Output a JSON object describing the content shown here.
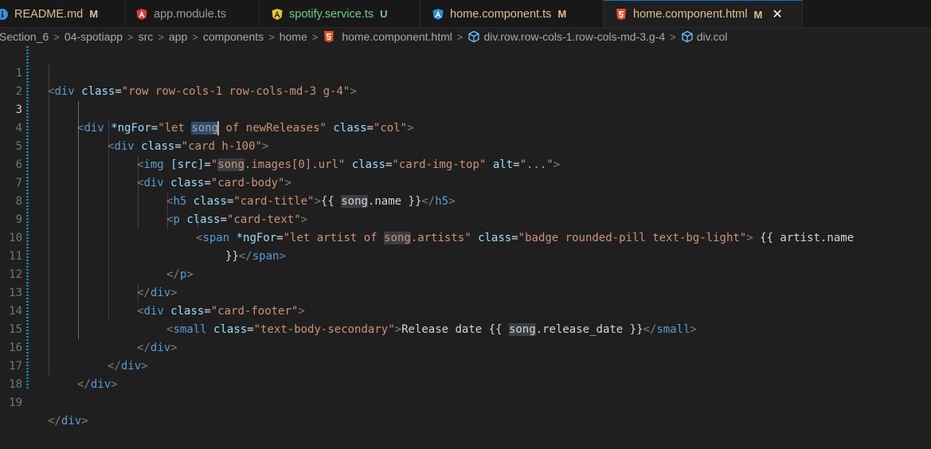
{
  "tabs": [
    {
      "label": "README.md",
      "status": "M",
      "icon": "info-icon",
      "active": false
    },
    {
      "label": "app.module.ts",
      "status": "",
      "icon": "angular-icon",
      "active": false
    },
    {
      "label": "spotify.service.ts",
      "status": "U",
      "icon": "angular-service-icon",
      "active": false
    },
    {
      "label": "home.component.ts",
      "status": "M",
      "icon": "angular-component-icon",
      "active": false
    },
    {
      "label": "home.component.html",
      "status": "M",
      "icon": "html5-icon",
      "active": true
    }
  ],
  "breadcrumb": [
    "Section_6",
    "04-spotiapp",
    "src",
    "app",
    "components",
    "home",
    "home.component.html",
    "div.row.row-cols-1.row-cols-md-3.g-4",
    "div.col"
  ],
  "line_numbers": [
    "1",
    "2",
    "3",
    "4",
    "5",
    "6",
    "7",
    "8",
    "9",
    "10",
    "11",
    "12",
    "13",
    "14",
    "15",
    "16",
    "17",
    "18",
    "19"
  ],
  "current_line": "3",
  "code": {
    "l1": {
      "o": "<",
      "tag": "div",
      "sp": " ",
      "a1": "class",
      "eq": "=",
      "v1": "\"row row-cols-1 row-cols-md-3 g-4\"",
      "c": ">"
    },
    "l3": {
      "o": "<",
      "tag": "div",
      "a1": "*ngFor",
      "eq": "=",
      "v1a": "\"let ",
      "sel": "song",
      "v1b": " of newReleases\"",
      "a2": "class",
      "v2": "\"col\"",
      "c": ">"
    },
    "l4": {
      "o": "<",
      "tag": "div",
      "a1": "class",
      "eq": "=",
      "v1": "\"card h-100\"",
      "c": ">"
    },
    "l5": {
      "o": "<",
      "tag": "img",
      "a1": "[src]",
      "eq": "=",
      "v1a": "\"",
      "hl": "song",
      "v1b": ".images[0].url\"",
      "a2": "class",
      "v2": "\"card-img-top\"",
      "a3": "alt",
      "v3": "\"...\"",
      "c": ">"
    },
    "l6": {
      "o": "<",
      "tag": "div",
      "a1": "class",
      "eq": "=",
      "v1": "\"card-body\"",
      "c": ">"
    },
    "l7": {
      "o": "<",
      "tag": "h5",
      "a1": "class",
      "eq": "=",
      "v1": "\"card-title\"",
      "c": ">",
      "t1": "{{ ",
      "hl": "song",
      "t2": ".name }}",
      "o2": "</",
      "tag2": "h5",
      "c2": ">"
    },
    "l8": {
      "o": "<",
      "tag": "p",
      "a1": "class",
      "eq": "=",
      "v1": "\"card-text\"",
      "c": ">"
    },
    "l9": {
      "o": "<",
      "tag": "span",
      "a1": "*ngFor",
      "eq": "=",
      "v1a": "\"let artist of ",
      "hl": "song",
      "v1b": ".artists\"",
      "a2": "class",
      "v2": "\"badge rounded-pill text-bg-light\"",
      "c": ">",
      "t1": " {{ artist.name"
    },
    "l10": {
      "t1": "}}",
      "o2": "</",
      "tag2": "span",
      "c2": ">"
    },
    "l11": {
      "o": "</",
      "tag": "p",
      "c": ">"
    },
    "l12": {
      "o": "</",
      "tag": "div",
      "c": ">"
    },
    "l13": {
      "o": "<",
      "tag": "div",
      "a1": "class",
      "eq": "=",
      "v1": "\"card-footer\"",
      "c": ">"
    },
    "l14": {
      "o": "<",
      "tag": "small",
      "a1": "class",
      "eq": "=",
      "v1": "\"text-body-secondary\"",
      "c": ">",
      "t1": "Release date {{ ",
      "hl": "song",
      "t2": ".release_date }}",
      "o2": "</",
      "tag2": "small",
      "c2": ">"
    },
    "l15": {
      "o": "</",
      "tag": "div",
      "c": ">"
    },
    "l16": {
      "o": "</",
      "tag": "div",
      "c": ">"
    },
    "l17": {
      "o": "</",
      "tag": "div",
      "c": ">"
    },
    "l19": {
      "o": "</",
      "tag": "div",
      "c": ">"
    }
  },
  "colors": {
    "tag": "#569cd6",
    "attr": "#9cdcfe",
    "string": "#ce9178",
    "text": "#d4d4d4",
    "modified": "#e2c08d",
    "untracked": "#73c991",
    "accent": "#0078d4"
  }
}
